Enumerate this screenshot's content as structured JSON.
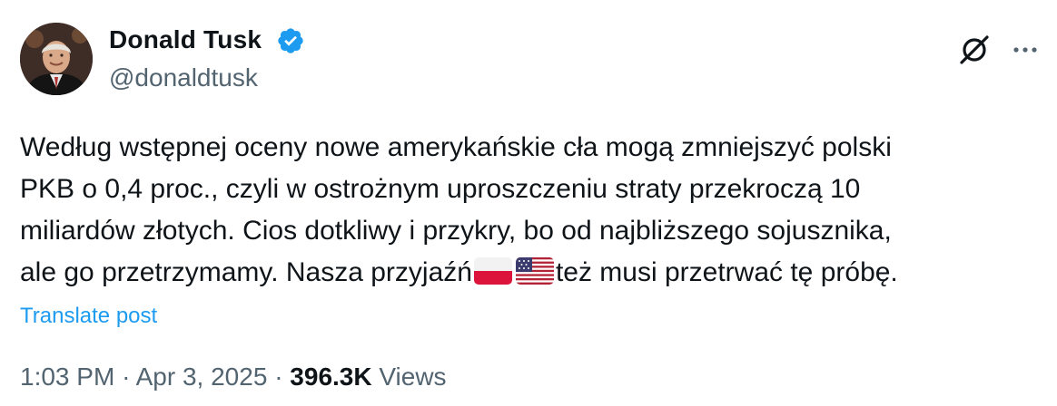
{
  "author": {
    "display_name": "Donald Tusk",
    "handle": "@donaldtusk",
    "verified": true,
    "verified_color": "#1d9bf0"
  },
  "actions": {
    "grok_icon": "grok-icon",
    "more_icon": "more-icon"
  },
  "tweet": {
    "lines": [
      "Według wstępnej oceny nowe amerykańskie cła mogą zmniejszyć polski",
      "PKB o 0,4 proc., czyli w ostrożnym uproszczeniu straty przekroczą 10",
      "miliardów złotych. Cios dotkliwy i przykry, bo od najbliższego sojusznika,",
      "ale go przetrzymamy. Nasza przyjaźń"
    ],
    "line4_tail": "też musi przetrwać tę próbę.",
    "flags": [
      "flag-poland-icon",
      "flag-usa-icon"
    ]
  },
  "translate_label": "Translate post",
  "meta": {
    "time": "1:03 PM",
    "separator": "·",
    "date": "Apr 3, 2025",
    "views_count": "396.3K",
    "views_label": "Views"
  },
  "colors": {
    "text": "#0f1419",
    "secondary": "#536471",
    "link": "#1d9bf0"
  }
}
